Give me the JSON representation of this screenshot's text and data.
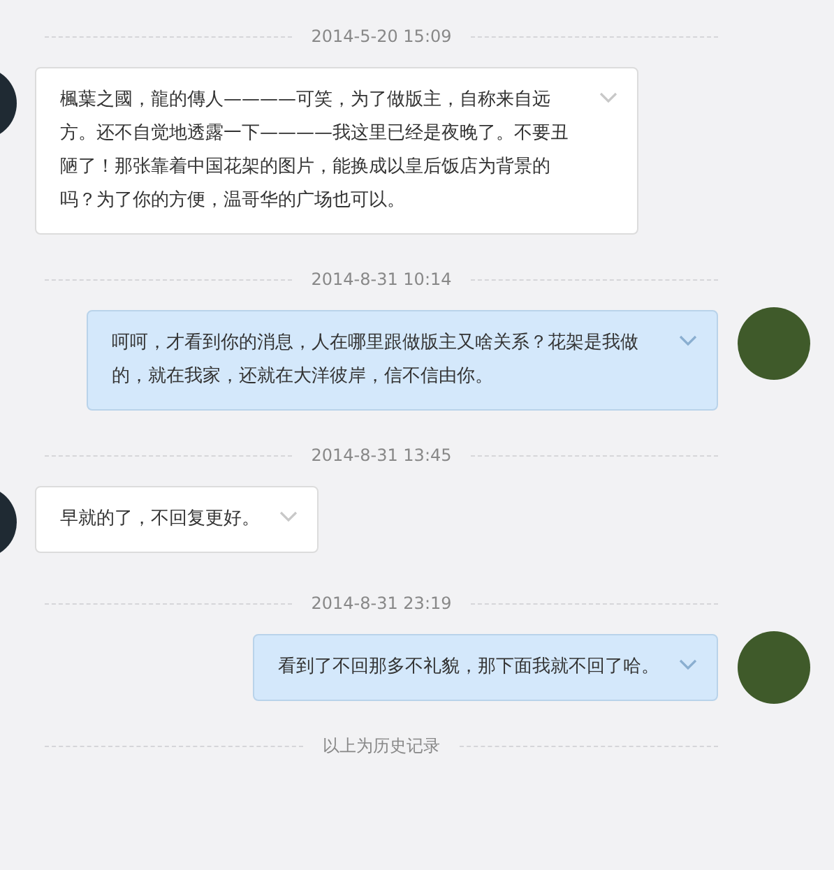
{
  "items": [
    {
      "kind": "time",
      "text": "2014-5-20 15:09"
    },
    {
      "kind": "incoming",
      "text": "楓葉之國，龍的傳人————可笑，为了做版主，自称来自远方。还不自觉地透露一下————我这里已经是夜晚了。不要丑陋了！那张靠着中国花架的图片，能换成以皇后饭店为背景的吗？为了你的方便，温哥华的广场也可以。"
    },
    {
      "kind": "time",
      "text": "2014-8-31 10:14"
    },
    {
      "kind": "outgoing",
      "text": "呵呵，才看到你的消息，人在哪里跟做版主又啥关系？花架是我做的，就在我家，还就在大洋彼岸，信不信由你。"
    },
    {
      "kind": "time",
      "text": "2014-8-31 13:45"
    },
    {
      "kind": "incoming",
      "text": "早就的了，不回复更好。"
    },
    {
      "kind": "time",
      "text": "2014-8-31 23:19"
    },
    {
      "kind": "outgoing",
      "text": "看到了不回那多不礼貌，那下面我就不回了哈。"
    },
    {
      "kind": "history",
      "text": "以上为历史记录"
    }
  ]
}
